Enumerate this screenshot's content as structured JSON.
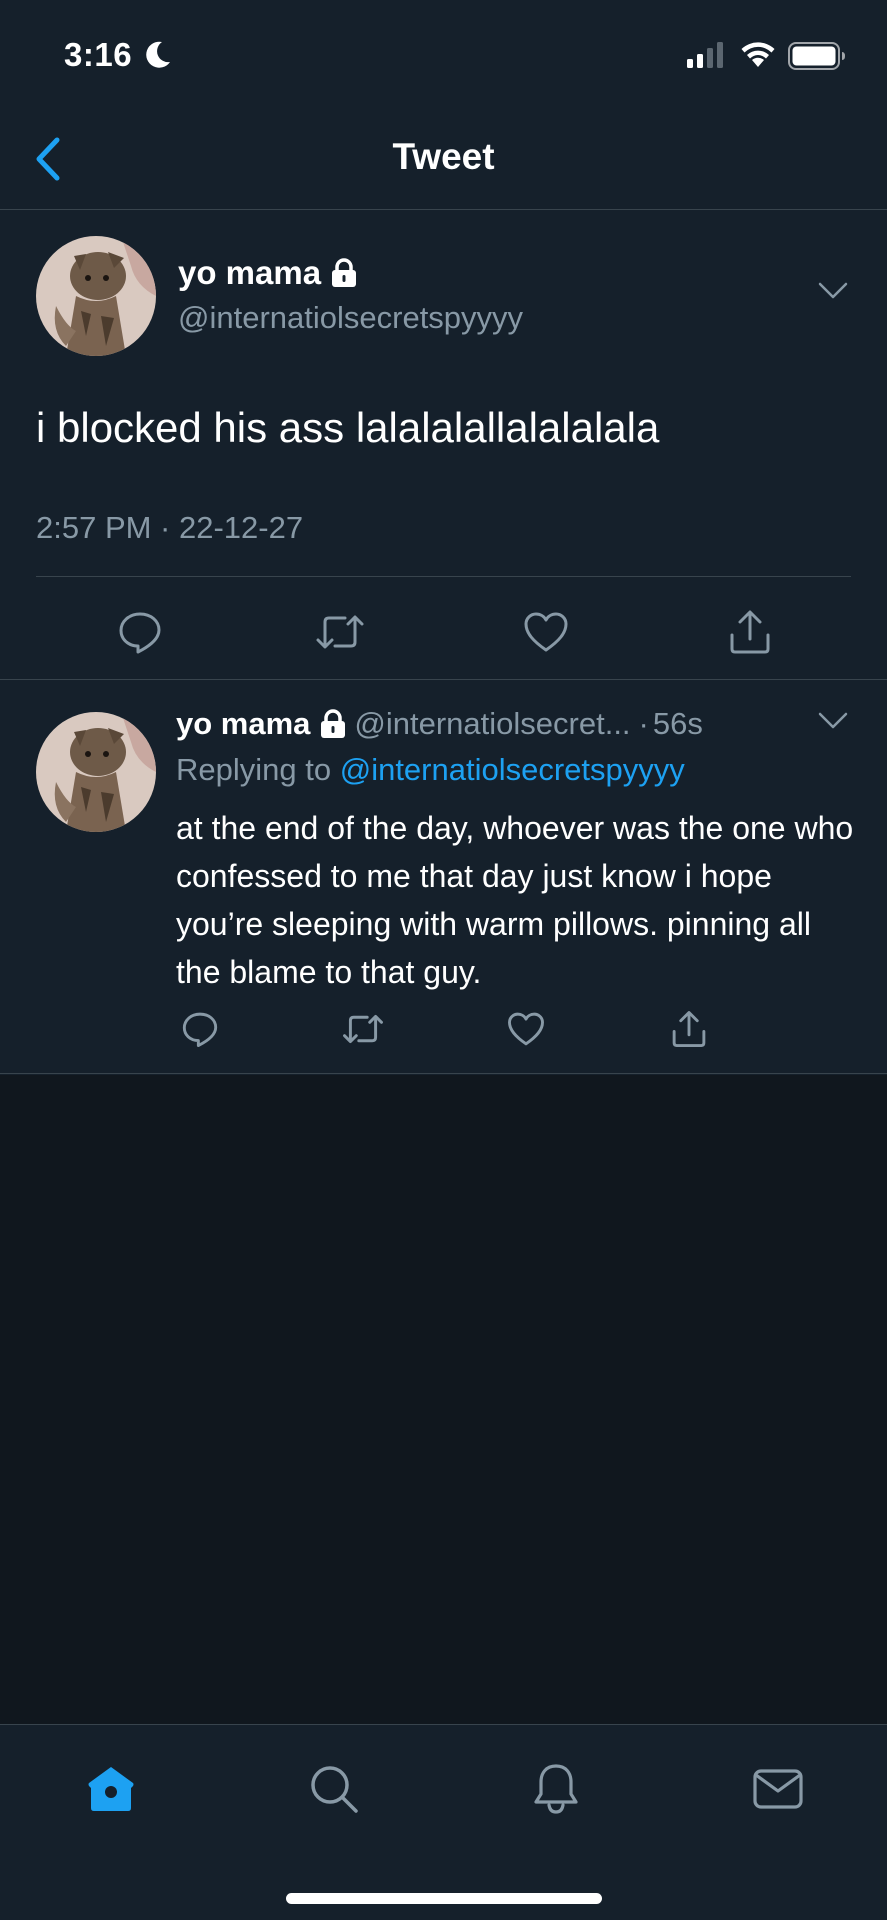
{
  "status_bar": {
    "time": "3:16",
    "icons": [
      "moon-icon",
      "signal-icon",
      "wifi-icon",
      "battery-icon"
    ]
  },
  "nav": {
    "title": "Tweet",
    "back_icon": "chevron-left-icon"
  },
  "main_tweet": {
    "display_name": "yo mama",
    "handle": "@internatiolsecretspyyyy",
    "text": "i blocked his ass lalalalallalalalala",
    "timestamp": "2:57 PM · 22-12-27",
    "actions": [
      "reply-icon",
      "retweet-icon",
      "like-icon",
      "share-icon"
    ]
  },
  "reply_tweet": {
    "display_name": "yo mama",
    "handle": "@internatiolsecret...",
    "dot": "·",
    "time": "56s",
    "replying_prefix": "Replying to",
    "replying_to": "@internatiolsecretspyyyy",
    "text": "at the end of the day, whoever was the one who confessed to me that day just know i hope you’re sleeping with warm pillows. pinning all the blame to that guy.",
    "actions": [
      "reply-icon",
      "retweet-icon",
      "like-icon",
      "share-icon"
    ]
  },
  "tab_bar": {
    "tabs": [
      "home-icon",
      "search-icon",
      "notifications-icon",
      "messages-icon"
    ],
    "active": "home-icon"
  },
  "colors": {
    "background": "#15202b",
    "empty_area": "#10171e",
    "accent": "#1da1f2",
    "secondary_text": "#8899a6",
    "divider": "#38444d"
  }
}
